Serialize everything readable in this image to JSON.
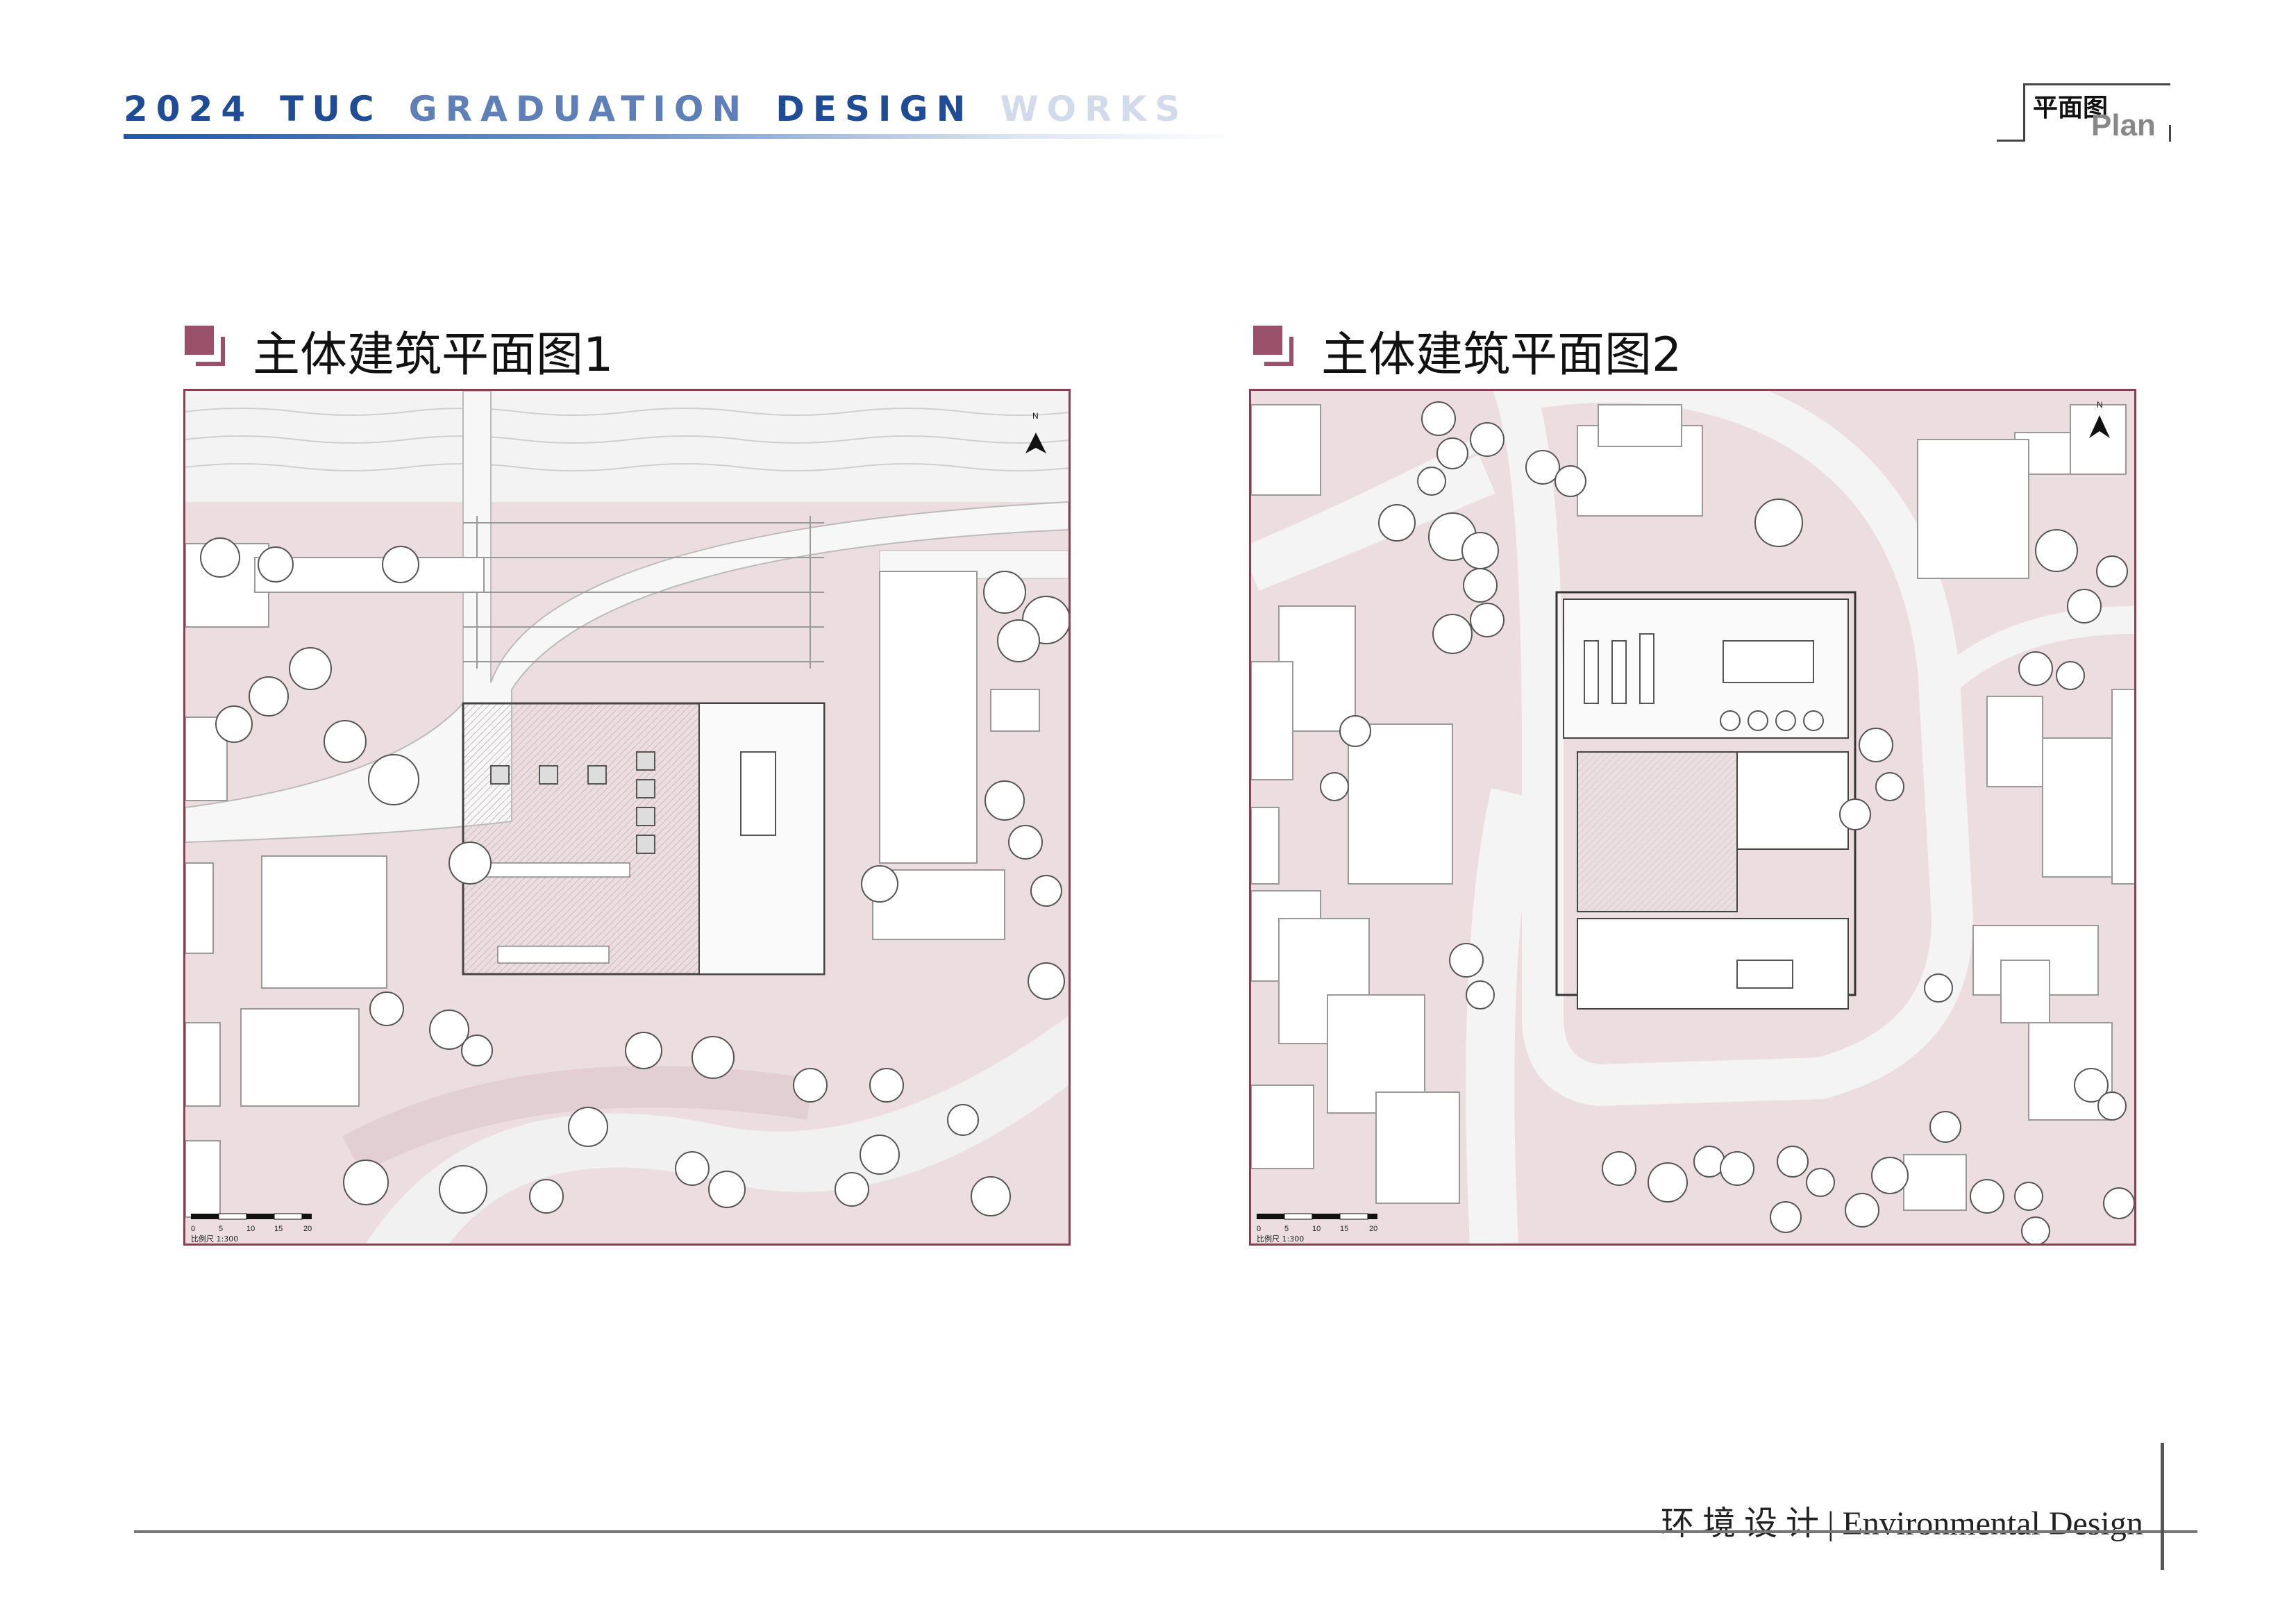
{
  "header": {
    "title_words": [
      {
        "text": "2024",
        "color": "#1f4c95"
      },
      {
        "text": "TUC",
        "color": "#1f4c95"
      },
      {
        "text": "GRADUATION",
        "color": "#5f7fb8"
      },
      {
        "text": "DESIGN",
        "color": "#1f4c95"
      },
      {
        "text": "WORKS",
        "color": "#d2dbeb"
      }
    ],
    "plan_tag_cn": "平面图",
    "plan_tag_en": "Plan"
  },
  "sections": [
    {
      "heading": "主体建筑平面图1",
      "north": "N",
      "scale_ticks": [
        "0",
        "5",
        "10",
        "15",
        "20"
      ],
      "scale_caption": "比例尺 1:300"
    },
    {
      "heading": "主体建筑平面图2",
      "north": "N",
      "scale_ticks": [
        "0",
        "5",
        "10",
        "15",
        "20"
      ],
      "scale_caption": "比例尺 1:300"
    }
  ],
  "footer": {
    "text": "环 境 设 计 | Environmental Design"
  },
  "colors": {
    "accent": "#9a5068",
    "frame": "#8a3f55",
    "ground": "#ecdde0",
    "path": "#f4f4f4"
  }
}
